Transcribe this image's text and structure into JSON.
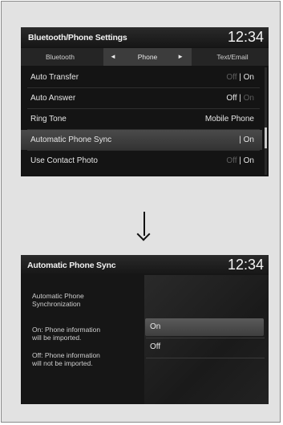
{
  "screen1": {
    "title": "Bluetooth/Phone Settings",
    "clock": "12:34",
    "tabs": {
      "left": "Bluetooth",
      "active": "Phone",
      "right": "Text/Email",
      "arrow_left": "◄",
      "arrow_right": "►"
    },
    "rows": [
      {
        "label": "Auto Transfer",
        "value_off": "Off",
        "value_on": "| On"
      },
      {
        "label": "Auto Answer",
        "value_off": "Off |",
        "value_on": "On"
      },
      {
        "label": "Ring Tone",
        "value": "Mobile Phone"
      },
      {
        "label": "Automatic Phone Sync",
        "value_off": "",
        "value_on": "| On"
      },
      {
        "label": "Use Contact Photo",
        "value_off": "Off",
        "value_on": "| On"
      }
    ]
  },
  "arrow_icon": "down-arrow-icon",
  "screen2": {
    "title": "Automatic Phone Sync",
    "clock": "12:34",
    "info": {
      "heading_line1": "Automatic Phone",
      "heading_line2": "Synchronization",
      "on_line1": "On: Phone information",
      "on_line2": "will be imported.",
      "off_line1": "Off: Phone information",
      "off_line2": "will not be imported."
    },
    "options": [
      "On",
      "Off"
    ],
    "selected_option": "On"
  }
}
